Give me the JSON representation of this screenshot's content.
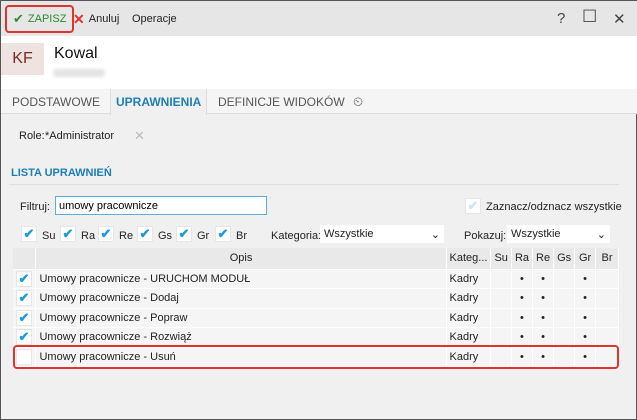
{
  "toolbar": {
    "save": "ZAPISZ",
    "cancel": "Anuluj",
    "operations": "Operacje",
    "help": "?",
    "maximize": "☐",
    "close": "✕"
  },
  "colors": {
    "accent": "#1d7fb5",
    "save": "#2e8b2e",
    "cancel": "#e0332f",
    "highlight": "#e0332f"
  },
  "header": {
    "initials": "KF",
    "name": "Kowal"
  },
  "tabs": [
    {
      "label": "PODSTAWOWE"
    },
    {
      "label": "UPRAWNIENIA",
      "active": true
    },
    {
      "label": "DEFINICJE WIDOKÓW"
    }
  ],
  "role": {
    "label": "Role:",
    "value": "*Administrator"
  },
  "list": {
    "title": "LISTA UPRAWNIEŃ",
    "filter_label": "Filtruj:",
    "filter_value": "umowy pracownicze",
    "select_all": "Zaznacz/odznacz wszystkie",
    "flags": [
      {
        "label": "Su",
        "checked": true
      },
      {
        "label": "Ra",
        "checked": true
      },
      {
        "label": "Re",
        "checked": true
      },
      {
        "label": "Gs",
        "checked": true
      },
      {
        "label": "Gr",
        "checked": true
      },
      {
        "label": "Br",
        "checked": true
      }
    ],
    "category_label": "Kategoria:",
    "category_value": "Wszystkie",
    "show_label": "Pokazuj:",
    "show_value": "Wszystkie"
  },
  "table": {
    "columns": [
      "Opis",
      "Kateg...",
      "Su",
      "Ra",
      "Re",
      "Gs",
      "Gr",
      "Br"
    ],
    "rows": [
      {
        "checked": true,
        "opis": "Umowy pracownicze - URUCHOM MODUŁ",
        "kategoria": "Kadry",
        "flags": [
          "",
          "•",
          "•",
          "",
          "•",
          ""
        ]
      },
      {
        "checked": true,
        "opis": "Umowy pracownicze - Dodaj",
        "kategoria": "Kadry",
        "flags": [
          "",
          "•",
          "•",
          "",
          "•",
          ""
        ]
      },
      {
        "checked": true,
        "opis": "Umowy pracownicze - Popraw",
        "kategoria": "Kadry",
        "flags": [
          "",
          "•",
          "•",
          "",
          "•",
          ""
        ]
      },
      {
        "checked": true,
        "opis": "Umowy pracownicze - Rozwiąż",
        "kategoria": "Kadry",
        "flags": [
          "",
          "•",
          "•",
          "",
          "•",
          ""
        ]
      },
      {
        "checked": false,
        "opis": "Umowy pracownicze - Usuń",
        "kategoria": "Kadry",
        "flags": [
          "",
          "•",
          "•",
          "",
          "•",
          ""
        ]
      }
    ]
  }
}
